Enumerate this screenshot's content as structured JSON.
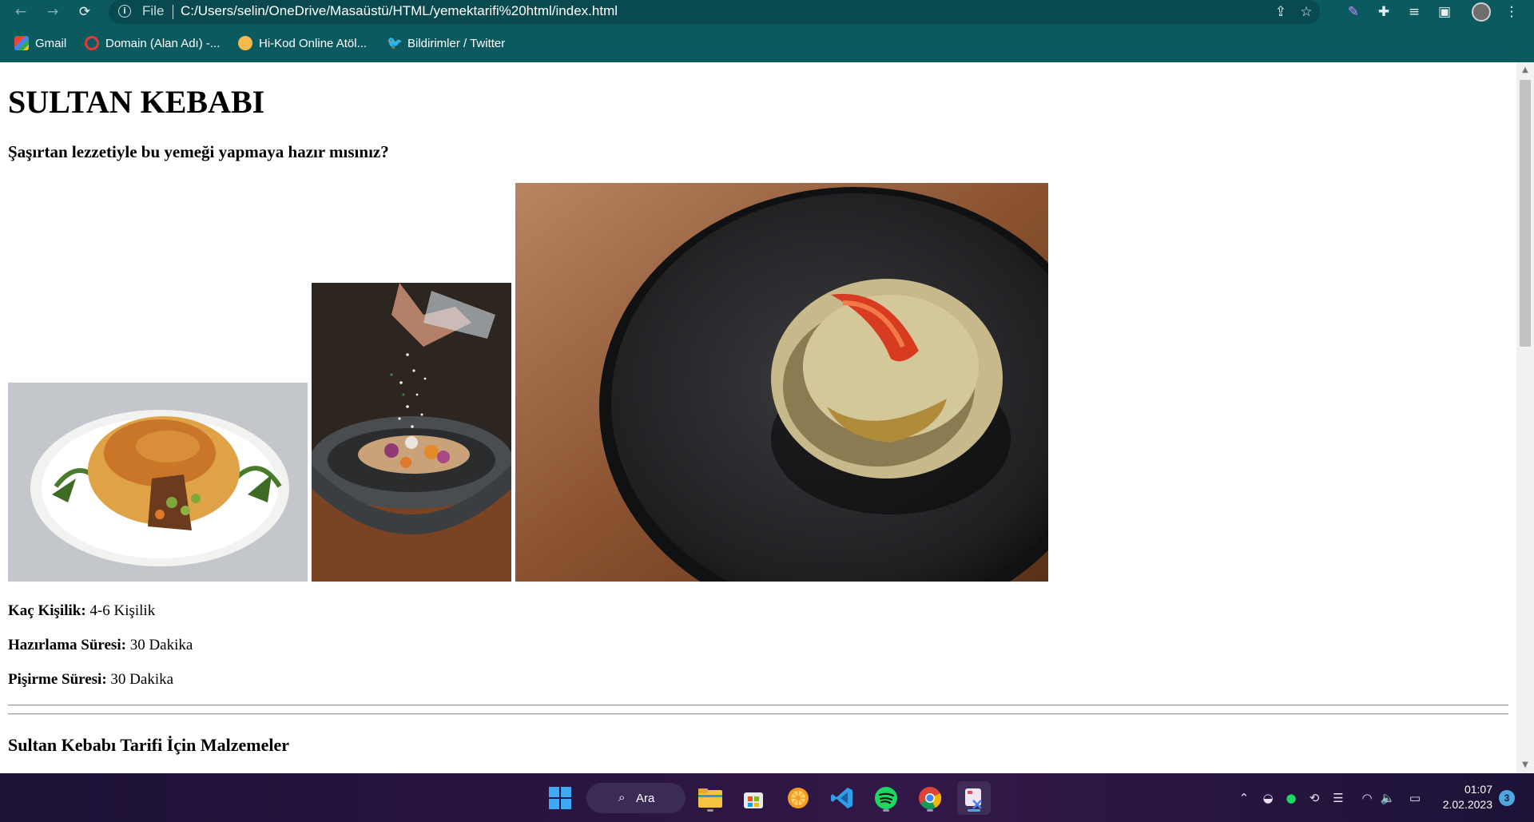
{
  "browser": {
    "back_icon": "←",
    "forward_icon": "→",
    "reload_icon": "⟳",
    "omnibox": {
      "info_icon": "i",
      "scheme_label": "File",
      "url": "C:/Users/selin/OneDrive/Masaüstü/HTML/yemektarifi%20html/index.html"
    },
    "bookmarks": [
      {
        "label": "Gmail",
        "icon": "gmail-icon",
        "color": "#ea4335"
      },
      {
        "label": "Domain (Alan Adı) -...",
        "icon": "domain-site-icon",
        "color": "#e53935"
      },
      {
        "label": "Hi-Kod Online Atöl...",
        "icon": "hikod-icon",
        "color": "#f6b94b"
      },
      {
        "label": "Bildirimler / Twitter",
        "icon": "twitter-icon",
        "color": "#1d9bf0"
      }
    ]
  },
  "page": {
    "title": "SULTAN KEBABI",
    "subtitle": "Şaşırtan lezzetiyle bu yemeği yapmaya hazır mısınız?",
    "images": [
      {
        "name": "sultan-kebabi-plate-photo",
        "description": "plated pastry dish"
      },
      {
        "name": "salt-sprinkle-bowl-photo",
        "description": "bowl with vegetables"
      },
      {
        "name": "dark-plate-photo",
        "description": "pastry on dark plate"
      }
    ],
    "info": [
      {
        "label": "Kaç Kişilik:",
        "value": "4-6 Kişilik"
      },
      {
        "label": "Hazırlama Süresi:",
        "value": "30 Dakika"
      },
      {
        "label": "Pişirme Süresi:",
        "value": "30 Dakika"
      }
    ],
    "ingredients_title": "Sultan Kebabı Tarifi İçin Malzemeler"
  },
  "taskbar": {
    "search_label": "Ara",
    "apps": [
      "windows-start-icon",
      "file-explorer-icon",
      "microsoft-store-icon",
      "fruit-app-icon",
      "vscode-icon",
      "spotify-icon",
      "chrome-icon",
      "snipping-tool-icon"
    ],
    "clock_time": "01:07",
    "clock_date": "2.02.2023",
    "notification_count": "3"
  },
  "colors": {
    "chrome_bg": "#0b5a60",
    "taskbar_bg": "#2a1540"
  }
}
